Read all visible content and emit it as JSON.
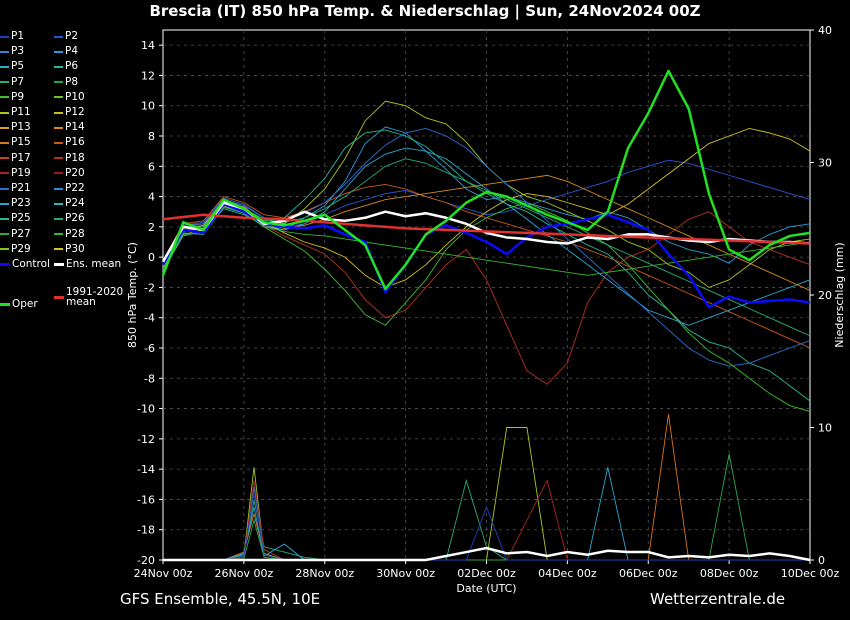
{
  "title": "Brescia  (IT)  850 hPa Temp. & Niederschlag | Sun, 24Nov2024 00Z",
  "footer": {
    "model": "GFS Ensemble, 45.5N, 10E",
    "source": "Wetterzentrale.de"
  },
  "legend": {
    "members": [
      {
        "label": "P1",
        "color": "#1f3fbf"
      },
      {
        "label": "P2",
        "color": "#2a55d4"
      },
      {
        "label": "P3",
        "color": "#3a7fd0"
      },
      {
        "label": "P4",
        "color": "#2f9bd6"
      },
      {
        "label": "P5",
        "color": "#2bb0c8"
      },
      {
        "label": "P6",
        "color": "#2ab59c"
      },
      {
        "label": "P7",
        "color": "#25b070"
      },
      {
        "label": "P8",
        "color": "#22a84a"
      },
      {
        "label": "P9",
        "color": "#3fbf2a"
      },
      {
        "label": "P10",
        "color": "#6cc624"
      },
      {
        "label": "P11",
        "color": "#a3c91f"
      },
      {
        "label": "P12",
        "color": "#c9c21c"
      },
      {
        "label": "P13",
        "color": "#d6a51c"
      },
      {
        "label": "P14",
        "color": "#d88a1c"
      },
      {
        "label": "P15",
        "color": "#d9741f"
      },
      {
        "label": "P16",
        "color": "#c9591f"
      },
      {
        "label": "P17",
        "color": "#c9441f"
      },
      {
        "label": "P18",
        "color": "#b8301f"
      },
      {
        "label": "P19",
        "color": "#a8231f"
      },
      {
        "label": "P20",
        "color": "#9a1c1c"
      },
      {
        "label": "P21",
        "color": "#2e6fd0"
      },
      {
        "label": "P22",
        "color": "#2a8ed6"
      },
      {
        "label": "P23",
        "color": "#2ba6d0"
      },
      {
        "label": "P24",
        "color": "#2ab8c0"
      },
      {
        "label": "P25",
        "color": "#28b896"
      },
      {
        "label": "P26",
        "color": "#25ae6e"
      },
      {
        "label": "P27",
        "color": "#2aa84a"
      },
      {
        "label": "P28",
        "color": "#39b52d"
      },
      {
        "label": "P29",
        "color": "#7cc61f"
      },
      {
        "label": "P30",
        "color": "#d6c21c"
      }
    ],
    "control": {
      "label": "Control",
      "color": "#0a0aff"
    },
    "ens_mean": {
      "label": "Ens. mean",
      "color": "#ffffff"
    },
    "oper": {
      "label": "Oper",
      "color": "#22e022"
    },
    "clim_mean": {
      "label": "1991-2020\nmean",
      "color": "#e03030"
    }
  },
  "chart_data": {
    "type": "line",
    "xlabel": "Date (UTC)",
    "ylabel": "850 hPa Temp. (°C)",
    "y2label": "Niederschlag (mm)",
    "ylim": [
      -20,
      15
    ],
    "y2lim": [
      0,
      40
    ],
    "xlim_hours": [
      0,
      384
    ],
    "x_ticks": [
      "24Nov 00z",
      "26Nov 00z",
      "28Nov 00z",
      "30Nov 00z",
      "02Dec 00z",
      "04Dec 00z",
      "06Dec 00z",
      "08Dec 00z",
      "10Dec 00z"
    ],
    "y_ticks": [
      14,
      12,
      10,
      8,
      6,
      4,
      2,
      0,
      -2,
      -4,
      -6,
      -8,
      -10,
      -12,
      -14,
      -16,
      -18,
      -20
    ],
    "y2_ticks": [
      40,
      30,
      20,
      10,
      0
    ],
    "grid": true,
    "series": [
      {
        "name": "Control",
        "color": "#0a0aff",
        "width": 2.5,
        "x": [
          0,
          12,
          24,
          36,
          48,
          60,
          72,
          84,
          96,
          108,
          120,
          132,
          144,
          156,
          168,
          180,
          192,
          204,
          216,
          228,
          240,
          252,
          264,
          276,
          288,
          300,
          312,
          324,
          336,
          348,
          360,
          372,
          384
        ],
        "y": [
          -0.5,
          1.8,
          1.6,
          3.5,
          3.0,
          2.2,
          2.0,
          1.9,
          2.1,
          1.5,
          1.0,
          -2.3,
          -0.5,
          1.5,
          2.1,
          1.6,
          1.0,
          0.2,
          1.3,
          2.0,
          2.2,
          2.5,
          2.8,
          2.3,
          1.8,
          0.2,
          -1.2,
          -3.3,
          -2.6,
          -3.0,
          -2.9,
          -2.8,
          -3.0
        ]
      },
      {
        "name": "Ens. mean",
        "color": "#ffffff",
        "width": 2.5,
        "x": [
          0,
          12,
          24,
          36,
          48,
          60,
          72,
          84,
          96,
          108,
          120,
          132,
          144,
          156,
          168,
          180,
          192,
          204,
          216,
          228,
          240,
          252,
          264,
          276,
          288,
          300,
          312,
          324,
          336,
          348,
          360,
          372,
          384
        ],
        "y": [
          -0.3,
          2.0,
          1.8,
          3.6,
          3.2,
          2.2,
          2.4,
          3.0,
          2.5,
          2.4,
          2.6,
          3.0,
          2.7,
          2.9,
          2.6,
          2.2,
          1.6,
          1.3,
          1.2,
          1.0,
          0.9,
          1.3,
          1.2,
          1.5,
          1.5,
          1.3,
          1.1,
          1.0,
          1.2,
          1.1,
          1.0,
          1.0,
          0.9
        ]
      },
      {
        "name": "1991-2020 mean",
        "color": "#e03030",
        "width": 2.5,
        "x": [
          0,
          24,
          48,
          72,
          96,
          120,
          144,
          168,
          192,
          216,
          240,
          264,
          288,
          312,
          336,
          360,
          384
        ],
        "y": [
          2.5,
          2.8,
          2.6,
          2.5,
          2.3,
          2.1,
          1.9,
          1.8,
          1.7,
          1.6,
          1.5,
          1.4,
          1.3,
          1.2,
          1.1,
          1.0,
          0.9
        ]
      },
      {
        "name": "Oper",
        "color": "#22e022",
        "width": 2.5,
        "x": [
          0,
          12,
          24,
          36,
          48,
          60,
          72,
          84,
          96,
          108,
          120,
          132,
          144,
          156,
          168,
          180,
          192,
          204,
          216,
          228,
          240,
          252,
          264,
          276,
          288,
          300,
          312,
          324,
          336,
          348,
          360,
          372,
          384
        ],
        "y": [
          -1.2,
          2.3,
          1.8,
          3.8,
          3.2,
          2.3,
          2.1,
          2.4,
          2.8,
          1.8,
          0.8,
          -2.1,
          -0.5,
          1.5,
          2.4,
          3.6,
          4.3,
          4.0,
          3.4,
          2.8,
          2.3,
          1.8,
          3.0,
          7.2,
          9.5,
          12.3,
          9.8,
          4.2,
          0.5,
          -0.2,
          0.8,
          1.4,
          1.6
        ]
      }
    ],
    "members_temp": [
      [
        -0.5,
        1.8,
        2.0,
        3.6,
        3.2,
        2.0,
        1.8,
        2.6,
        3.4,
        5.0,
        7.5,
        8.6,
        8.2,
        7.0,
        5.8,
        4.5,
        3.8,
        4.0,
        3.6,
        3.2,
        2.8,
        2.5,
        3.0,
        2.6,
        1.8,
        1.0,
        0.5,
        0.2,
        -0.4,
        0.8,
        1.5,
        2.0,
        2.2
      ],
      [
        -0.8,
        1.5,
        1.8,
        3.4,
        2.9,
        2.5,
        2.2,
        3.2,
        4.5,
        6.5,
        9.0,
        10.3,
        10.0,
        9.2,
        8.8,
        7.6,
        6.0,
        4.8,
        4.0,
        3.6,
        3.0,
        2.4,
        1.8,
        1.0,
        0.5,
        -0.5,
        -1.0,
        -2.0,
        -1.5,
        -0.5,
        0.5,
        1.0,
        1.2
      ],
      [
        -0.4,
        2.0,
        2.2,
        3.8,
        3.4,
        2.1,
        1.4,
        0.8,
        0.2,
        -1.0,
        -2.8,
        -4.0,
        -3.5,
        -2.0,
        -0.5,
        0.5,
        -1.5,
        -4.5,
        -7.5,
        -8.4,
        -7.0,
        -3.0,
        -1.0,
        0.0,
        0.5,
        1.5,
        2.5,
        3.0,
        2.0,
        1.0,
        0.5,
        0.0,
        -0.5
      ],
      [
        -0.6,
        1.6,
        1.5,
        3.3,
        3.0,
        2.4,
        2.6,
        3.8,
        5.2,
        7.2,
        8.2,
        8.4,
        8.0,
        7.3,
        6.2,
        5.0,
        4.2,
        3.5,
        3.0,
        2.2,
        1.5,
        0.8,
        0.2,
        -1.0,
        -2.5,
        -3.5,
        -4.8,
        -5.6,
        -6.0,
        -7.0,
        -7.5,
        -8.5,
        -9.5
      ],
      [
        -0.3,
        2.1,
        2.3,
        3.9,
        3.5,
        2.6,
        2.0,
        2.2,
        2.8,
        3.4,
        3.8,
        4.2,
        4.4,
        4.0,
        3.6,
        3.2,
        2.8,
        3.0,
        3.4,
        3.8,
        4.2,
        4.6,
        5.0,
        5.6,
        6.0,
        6.4,
        6.2,
        5.8,
        5.4,
        5.0,
        4.6,
        4.2,
        3.8
      ],
      [
        -0.7,
        1.7,
        1.9,
        3.5,
        3.1,
        2.0,
        1.2,
        0.4,
        -0.8,
        -2.2,
        -3.8,
        -4.5,
        -3.0,
        -1.5,
        0.5,
        1.8,
        2.6,
        3.2,
        3.6,
        3.0,
        2.4,
        1.6,
        0.8,
        -0.5,
        -2.0,
        -3.5,
        -5.0,
        -6.2,
        -7.0,
        -8.0,
        -9.0,
        -9.8,
        -10.2
      ],
      [
        -0.2,
        2.2,
        2.4,
        4.0,
        3.6,
        2.8,
        2.6,
        3.0,
        3.6,
        4.2,
        4.6,
        4.8,
        4.5,
        4.0,
        3.6,
        3.0,
        2.6,
        2.2,
        1.8,
        1.4,
        1.0,
        0.5,
        0.0,
        -0.6,
        -1.2,
        -1.8,
        -2.4,
        -3.0,
        -3.6,
        -4.2,
        -4.8,
        -5.4,
        -6.0
      ],
      [
        -0.9,
        1.4,
        1.7,
        3.2,
        2.8,
        2.1,
        1.8,
        2.2,
        3.0,
        4.5,
        6.0,
        6.8,
        7.2,
        7.0,
        6.5,
        5.5,
        4.5,
        3.5,
        2.5,
        1.5,
        0.5,
        -0.5,
        -1.5,
        -2.5,
        -3.5,
        -4.0,
        -4.5,
        -4.0,
        -3.5,
        -3.0,
        -2.5,
        -2.0,
        -1.5
      ],
      [
        -0.5,
        1.9,
        2.1,
        3.7,
        3.3,
        2.3,
        1.6,
        1.0,
        0.6,
        0.0,
        -1.2,
        -2.0,
        -1.5,
        -0.5,
        0.8,
        2.0,
        3.0,
        3.8,
        4.2,
        4.0,
        3.6,
        3.2,
        2.8,
        3.5,
        4.5,
        5.5,
        6.5,
        7.5,
        8.0,
        8.5,
        8.2,
        7.8,
        7.0
      ],
      [
        -0.4,
        2.0,
        2.0,
        3.6,
        3.2,
        2.5,
        2.3,
        2.6,
        3.2,
        4.0,
        5.0,
        6.0,
        6.5,
        6.2,
        5.6,
        5.0,
        4.4,
        3.8,
        3.2,
        2.6,
        2.0,
        1.4,
        0.8,
        0.2,
        -0.4,
        -1.0,
        -1.6,
        -2.2,
        -2.8,
        -3.4,
        -4.0,
        -4.6,
        -5.2
      ],
      [
        -0.6,
        1.8,
        1.9,
        3.5,
        3.1,
        2.2,
        1.9,
        2.1,
        2.5,
        3.0,
        3.4,
        3.8,
        4.0,
        4.2,
        4.4,
        4.6,
        4.8,
        5.0,
        5.2,
        5.4,
        5.0,
        4.4,
        3.8,
        3.2,
        2.6,
        2.0,
        1.4,
        0.8,
        0.2,
        -0.4,
        -1.0,
        -1.6,
        -2.2
      ],
      [
        -0.3,
        2.1,
        2.2,
        3.8,
        3.4,
        2.6,
        2.4,
        2.9,
        3.6,
        4.8,
        6.2,
        7.4,
        8.2,
        8.5,
        8.0,
        7.2,
        6.0,
        4.8,
        3.6,
        2.4,
        1.2,
        0.0,
        -1.2,
        -2.4,
        -3.6,
        -4.8,
        -6.0,
        -6.8,
        -7.2,
        -7.0,
        -6.5,
        -6.0,
        -5.5
      ],
      [
        -0.8,
        1.5,
        1.6,
        3.3,
        2.9,
        2.0,
        1.7,
        1.5,
        1.4,
        1.2,
        1.0,
        0.8,
        0.6,
        0.4,
        0.2,
        0.0,
        -0.2,
        -0.4,
        -0.6,
        -0.8,
        -1.0,
        -1.2,
        -1.0,
        -0.8,
        -0.6,
        -0.4,
        -0.2,
        0.0,
        0.2,
        0.4,
        0.6,
        0.8,
        1.0
      ]
    ],
    "precip_x": [
      0,
      12,
      24,
      36,
      48,
      54,
      60,
      72,
      84,
      96,
      108,
      120,
      132,
      144,
      156,
      168,
      180,
      192,
      204,
      216,
      228,
      240,
      252,
      264,
      276,
      288,
      300,
      312,
      324,
      336,
      348,
      360,
      372,
      384
    ],
    "precip_mean": [
      0,
      0,
      0,
      0,
      0,
      0,
      0,
      0,
      0,
      0,
      0,
      0,
      0,
      0,
      0,
      0.3,
      0.6,
      0.9,
      0.5,
      0.6,
      0.3,
      0.6,
      0.4,
      0.7,
      0.6,
      0.6,
      0.2,
      0.3,
      0.2,
      0.4,
      0.3,
      0.5,
      0.3,
      0
    ],
    "precip_members": [
      [
        0,
        0,
        0,
        0,
        0.5,
        5.5,
        0.8,
        0,
        0,
        0,
        0,
        0,
        0,
        0,
        0,
        0,
        0,
        0,
        0,
        0,
        0,
        0,
        0,
        0,
        0,
        0,
        0,
        0,
        0,
        0,
        0,
        0,
        0,
        0
      ],
      [
        0,
        0,
        0,
        0,
        0.4,
        4.5,
        1.0,
        0.6,
        0.2,
        0,
        0,
        0,
        0,
        0,
        0,
        0,
        6.0,
        1.0,
        0,
        0,
        0,
        0,
        0,
        0,
        0,
        0,
        0,
        0,
        0,
        0,
        0,
        0,
        0,
        0
      ],
      [
        0,
        0,
        0,
        0,
        0.3,
        7.0,
        0.5,
        0,
        0,
        0,
        0,
        0,
        0,
        0,
        0,
        0,
        0,
        0,
        10.0,
        10.0,
        0,
        0,
        0,
        0,
        0,
        0,
        0,
        0,
        0,
        0,
        0,
        0,
        0,
        0
      ],
      [
        0,
        0,
        0,
        0,
        0.6,
        3.5,
        0.4,
        0,
        0,
        0,
        0,
        0,
        0,
        0,
        0,
        0,
        0,
        0,
        0,
        0,
        0,
        0,
        0,
        0,
        0,
        0,
        11.0,
        0,
        0,
        0,
        0,
        0,
        0,
        0
      ],
      [
        0,
        0,
        0,
        0,
        0.2,
        6.0,
        0.8,
        0,
        0,
        0,
        0,
        0,
        0,
        0,
        0,
        0,
        0,
        0,
        0,
        3.0,
        6.0,
        0,
        0,
        0,
        0,
        0,
        0,
        0,
        0,
        0,
        0,
        0,
        0,
        0
      ],
      [
        0,
        0,
        0,
        0,
        0.5,
        4.0,
        0.3,
        1.2,
        0,
        0,
        0,
        0,
        0,
        0,
        0,
        0,
        0,
        0,
        0,
        0,
        0,
        0,
        0,
        7.0,
        0,
        0,
        0,
        0,
        0,
        0,
        0,
        0,
        0,
        0
      ],
      [
        0,
        0,
        0,
        0,
        0.1,
        3.0,
        0.2,
        0,
        0,
        0,
        0,
        0,
        0,
        0,
        0,
        0,
        0,
        0,
        0,
        0,
        0,
        0,
        0,
        0,
        0,
        0,
        0,
        0,
        0,
        8.0,
        0,
        0,
        0,
        0
      ],
      [
        0,
        0,
        0,
        0,
        0.3,
        5.0,
        0.4,
        0,
        0,
        0,
        0,
        0,
        0,
        0,
        0,
        0,
        0,
        4.0,
        0,
        0,
        0,
        0,
        0,
        0,
        0,
        0,
        0,
        0,
        0,
        0,
        0,
        0,
        0,
        0
      ]
    ]
  }
}
